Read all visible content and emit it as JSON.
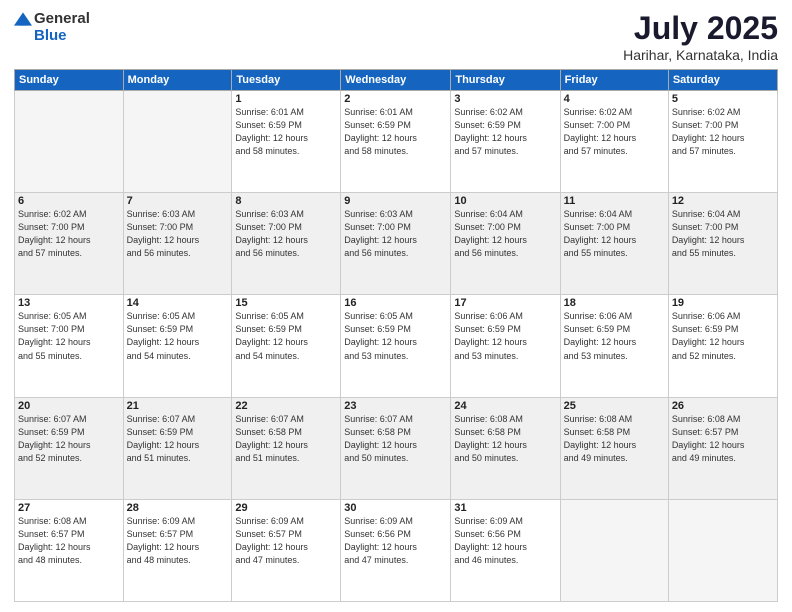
{
  "logo": {
    "general": "General",
    "blue": "Blue"
  },
  "header": {
    "month": "July 2025",
    "location": "Harihar, Karnataka, India"
  },
  "weekdays": [
    "Sunday",
    "Monday",
    "Tuesday",
    "Wednesday",
    "Thursday",
    "Friday",
    "Saturday"
  ],
  "weeks": [
    [
      {
        "day": "",
        "info": ""
      },
      {
        "day": "",
        "info": ""
      },
      {
        "day": "1",
        "info": "Sunrise: 6:01 AM\nSunset: 6:59 PM\nDaylight: 12 hours\nand 58 minutes."
      },
      {
        "day": "2",
        "info": "Sunrise: 6:01 AM\nSunset: 6:59 PM\nDaylight: 12 hours\nand 58 minutes."
      },
      {
        "day": "3",
        "info": "Sunrise: 6:02 AM\nSunset: 6:59 PM\nDaylight: 12 hours\nand 57 minutes."
      },
      {
        "day": "4",
        "info": "Sunrise: 6:02 AM\nSunset: 7:00 PM\nDaylight: 12 hours\nand 57 minutes."
      },
      {
        "day": "5",
        "info": "Sunrise: 6:02 AM\nSunset: 7:00 PM\nDaylight: 12 hours\nand 57 minutes."
      }
    ],
    [
      {
        "day": "6",
        "info": "Sunrise: 6:02 AM\nSunset: 7:00 PM\nDaylight: 12 hours\nand 57 minutes."
      },
      {
        "day": "7",
        "info": "Sunrise: 6:03 AM\nSunset: 7:00 PM\nDaylight: 12 hours\nand 56 minutes."
      },
      {
        "day": "8",
        "info": "Sunrise: 6:03 AM\nSunset: 7:00 PM\nDaylight: 12 hours\nand 56 minutes."
      },
      {
        "day": "9",
        "info": "Sunrise: 6:03 AM\nSunset: 7:00 PM\nDaylight: 12 hours\nand 56 minutes."
      },
      {
        "day": "10",
        "info": "Sunrise: 6:04 AM\nSunset: 7:00 PM\nDaylight: 12 hours\nand 56 minutes."
      },
      {
        "day": "11",
        "info": "Sunrise: 6:04 AM\nSunset: 7:00 PM\nDaylight: 12 hours\nand 55 minutes."
      },
      {
        "day": "12",
        "info": "Sunrise: 6:04 AM\nSunset: 7:00 PM\nDaylight: 12 hours\nand 55 minutes."
      }
    ],
    [
      {
        "day": "13",
        "info": "Sunrise: 6:05 AM\nSunset: 7:00 PM\nDaylight: 12 hours\nand 55 minutes."
      },
      {
        "day": "14",
        "info": "Sunrise: 6:05 AM\nSunset: 6:59 PM\nDaylight: 12 hours\nand 54 minutes."
      },
      {
        "day": "15",
        "info": "Sunrise: 6:05 AM\nSunset: 6:59 PM\nDaylight: 12 hours\nand 54 minutes."
      },
      {
        "day": "16",
        "info": "Sunrise: 6:05 AM\nSunset: 6:59 PM\nDaylight: 12 hours\nand 53 minutes."
      },
      {
        "day": "17",
        "info": "Sunrise: 6:06 AM\nSunset: 6:59 PM\nDaylight: 12 hours\nand 53 minutes."
      },
      {
        "day": "18",
        "info": "Sunrise: 6:06 AM\nSunset: 6:59 PM\nDaylight: 12 hours\nand 53 minutes."
      },
      {
        "day": "19",
        "info": "Sunrise: 6:06 AM\nSunset: 6:59 PM\nDaylight: 12 hours\nand 52 minutes."
      }
    ],
    [
      {
        "day": "20",
        "info": "Sunrise: 6:07 AM\nSunset: 6:59 PM\nDaylight: 12 hours\nand 52 minutes."
      },
      {
        "day": "21",
        "info": "Sunrise: 6:07 AM\nSunset: 6:59 PM\nDaylight: 12 hours\nand 51 minutes."
      },
      {
        "day": "22",
        "info": "Sunrise: 6:07 AM\nSunset: 6:58 PM\nDaylight: 12 hours\nand 51 minutes."
      },
      {
        "day": "23",
        "info": "Sunrise: 6:07 AM\nSunset: 6:58 PM\nDaylight: 12 hours\nand 50 minutes."
      },
      {
        "day": "24",
        "info": "Sunrise: 6:08 AM\nSunset: 6:58 PM\nDaylight: 12 hours\nand 50 minutes."
      },
      {
        "day": "25",
        "info": "Sunrise: 6:08 AM\nSunset: 6:58 PM\nDaylight: 12 hours\nand 49 minutes."
      },
      {
        "day": "26",
        "info": "Sunrise: 6:08 AM\nSunset: 6:57 PM\nDaylight: 12 hours\nand 49 minutes."
      }
    ],
    [
      {
        "day": "27",
        "info": "Sunrise: 6:08 AM\nSunset: 6:57 PM\nDaylight: 12 hours\nand 48 minutes."
      },
      {
        "day": "28",
        "info": "Sunrise: 6:09 AM\nSunset: 6:57 PM\nDaylight: 12 hours\nand 48 minutes."
      },
      {
        "day": "29",
        "info": "Sunrise: 6:09 AM\nSunset: 6:57 PM\nDaylight: 12 hours\nand 47 minutes."
      },
      {
        "day": "30",
        "info": "Sunrise: 6:09 AM\nSunset: 6:56 PM\nDaylight: 12 hours\nand 47 minutes."
      },
      {
        "day": "31",
        "info": "Sunrise: 6:09 AM\nSunset: 6:56 PM\nDaylight: 12 hours\nand 46 minutes."
      },
      {
        "day": "",
        "info": ""
      },
      {
        "day": "",
        "info": ""
      }
    ]
  ],
  "empty_rows": [
    0,
    1
  ]
}
